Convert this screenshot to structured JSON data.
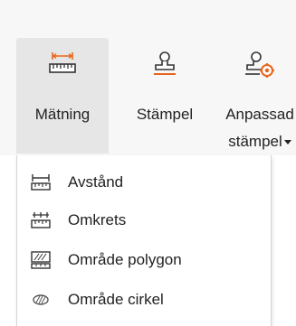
{
  "ribbon": {
    "buttons": [
      {
        "label": "Mätning",
        "icon": "ruler-measure-icon"
      },
      {
        "label": "Stämpel",
        "icon": "stamp-icon"
      },
      {
        "label": "Anpassad",
        "label_line2": "stämpel",
        "icon": "custom-stamp-icon"
      }
    ]
  },
  "menu": {
    "items": [
      {
        "label": "Avstånd",
        "icon": "distance-measure-icon"
      },
      {
        "label": "Omkrets",
        "icon": "perimeter-measure-icon"
      },
      {
        "label": "Område polygon",
        "icon": "polygon-area-icon"
      },
      {
        "label": "Område cirkel",
        "icon": "circle-area-icon"
      }
    ]
  },
  "colors": {
    "accent_orange": "#e8641b",
    "selected_bg": "#e6e6e6",
    "ribbon_bg": "#f7f7f7",
    "icon_dark": "#333333"
  }
}
